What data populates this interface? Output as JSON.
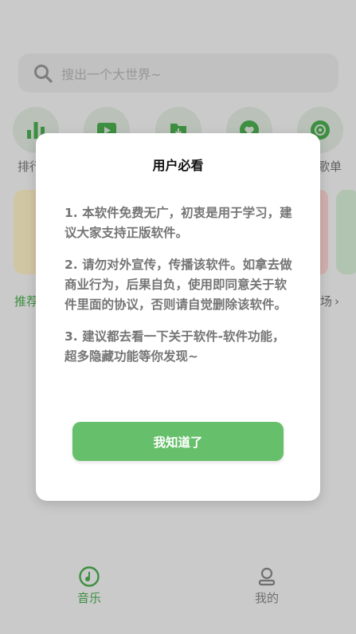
{
  "search": {
    "placeholder": "搜出一个大世界~"
  },
  "categories": [
    {
      "label": "排行",
      "icon": "bar-chart-icon"
    },
    {
      "label": "",
      "icon": "video-icon"
    },
    {
      "label": "",
      "icon": "download-folder-icon"
    },
    {
      "label": "",
      "icon": "heart-icon"
    },
    {
      "label": "歌单",
      "icon": "disc-icon"
    }
  ],
  "sections": {
    "left_label": "推荐",
    "right_label": "场"
  },
  "tabs": [
    {
      "label": "音乐",
      "icon": "music-disc-icon",
      "active": true
    },
    {
      "label": "我的",
      "icon": "profile-icon",
      "active": false
    }
  ],
  "dialog": {
    "title": "用户必看",
    "paragraphs": [
      "1. 本软件免费无广，初衷是用于学习，建议大家支持正版软件。",
      "2. 请勿对外宣传，传播该软件。如拿去做商业行为，后果自负，使用即同意关于软件里面的协议，否则请自觉删除该软件。",
      "3. 建议都去看一下关于软件-软件功能，超多隐藏功能等你发现~"
    ],
    "confirm_label": "我知道了"
  },
  "colors": {
    "accent": "#66bf6a",
    "overlay": "rgba(0,0,0,0.18)"
  }
}
